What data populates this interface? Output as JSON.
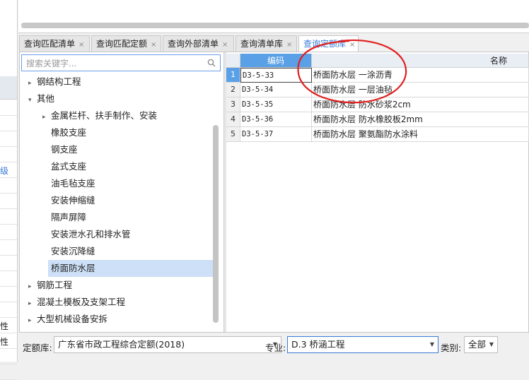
{
  "left_strip": {
    "rows": [
      "",
      "",
      "",
      "",
      "级",
      "",
      "",
      "",
      "",
      "",
      "",
      "",
      "",
      "",
      "性",
      "性",
      "",
      ""
    ]
  },
  "tabs": [
    {
      "label": "查询匹配清单",
      "close": "×"
    },
    {
      "label": "查询匹配定额",
      "close": "×"
    },
    {
      "label": "查询外部清单",
      "close": "×"
    },
    {
      "label": "查询清单库",
      "close": "×"
    },
    {
      "label": "查询定额库",
      "close": "×",
      "active": true
    }
  ],
  "search": {
    "placeholder": "搜索关键字..."
  },
  "tree": [
    {
      "label": "钢结构工程",
      "arrow": "▸",
      "level": 0
    },
    {
      "label": "其他",
      "arrow": "▾",
      "level": 0
    },
    {
      "label": "金属栏杆、扶手制作、安装",
      "arrow": "▸",
      "level": 1
    },
    {
      "label": "橡胶支座",
      "arrow": "",
      "level": 1
    },
    {
      "label": "钢支座",
      "arrow": "",
      "level": 1
    },
    {
      "label": "盆式支座",
      "arrow": "",
      "level": 1
    },
    {
      "label": "油毛毡支座",
      "arrow": "",
      "level": 1
    },
    {
      "label": "安装伸缩缝",
      "arrow": "",
      "level": 1
    },
    {
      "label": "隔声屏障",
      "arrow": "",
      "level": 1
    },
    {
      "label": "安装泄水孔和排水管",
      "arrow": "",
      "level": 1
    },
    {
      "label": "安装沉降缝",
      "arrow": "",
      "level": 1
    },
    {
      "label": "桥面防水层",
      "arrow": "",
      "level": 1,
      "selected": true
    },
    {
      "label": "钢筋工程",
      "arrow": "▸",
      "level": 0
    },
    {
      "label": "混凝土模板及支架工程",
      "arrow": "▸",
      "level": 0
    },
    {
      "label": "大型机械设备安拆",
      "arrow": "▸",
      "level": 0
    }
  ],
  "grid": {
    "headers": {
      "code": "编码",
      "name": "名称"
    },
    "rows": [
      {
        "n": "1",
        "code": "D3-5-33",
        "name": "桥面防水层 一涂沥青"
      },
      {
        "n": "2",
        "code": "D3-5-34",
        "name": "桥面防水层 一层油毡"
      },
      {
        "n": "3",
        "code": "D3-5-35",
        "name": "桥面防水层 防水砂浆2cm"
      },
      {
        "n": "4",
        "code": "D3-5-36",
        "name": "桥面防水层 防水橡胶板2mm"
      },
      {
        "n": "5",
        "code": "D3-5-37",
        "name": "桥面防水层 聚氨酯防水涂料"
      }
    ]
  },
  "footer": {
    "quota_label": "定额库:",
    "quota_value": "广东省市政工程综合定额(2018)",
    "major_label": "专业:",
    "major_value": "D.3 桥涵工程",
    "category_label": "类别:",
    "category_value": "全部"
  },
  "colors": {
    "accent": "#3a7bd5",
    "annotation": "#e02020",
    "selected_row": "#cde0f7"
  }
}
